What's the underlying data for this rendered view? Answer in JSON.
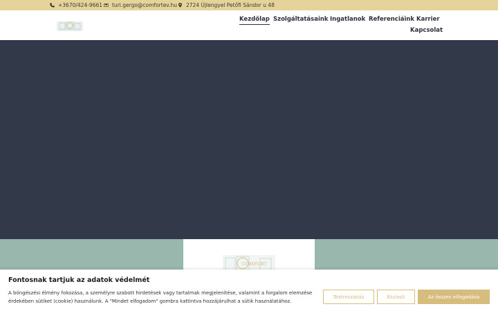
{
  "topbar": {
    "phone": "+3670/424-9661",
    "email": "turi.gergo@comfortev.hu",
    "address": "2724 Újlengyel Petőfi Sándor u 48",
    "icons": [
      "phone-icon",
      "envelope-icon",
      "map-pin-icon"
    ]
  },
  "header": {
    "nav": [
      {
        "label": "Kezdőlap",
        "active": true
      },
      {
        "label": "Szolgáltatásaink"
      },
      {
        "label": "Ingatlanok"
      },
      {
        "label": "Referenciáink"
      },
      {
        "label": "Karrier"
      },
      {
        "label": "Kapcsolat"
      }
    ]
  },
  "card": {
    "logo_text": "COMFORT"
  },
  "cookie": {
    "title": "Fontosnak tartjuk az adatok védelmét",
    "text": "A böngészési élmény fokozása, a személyre szabott hirdetések vagy tartalmak megjelenítése, valamint a forgalom elemzése érdekében sütiket (cookie) használunk. A \"Mindet elfogadom\" gombra kattintva hozzájárulhat a sütik használatához.",
    "customize": "Testreszabás",
    "reject": "Elutasít",
    "accept_all": "Az összes elfogadása"
  },
  "colors": {
    "topbar": "#e6d39a",
    "hero": "#323a4a",
    "band": "#99b7ad",
    "accent": "#d6bd7d"
  }
}
